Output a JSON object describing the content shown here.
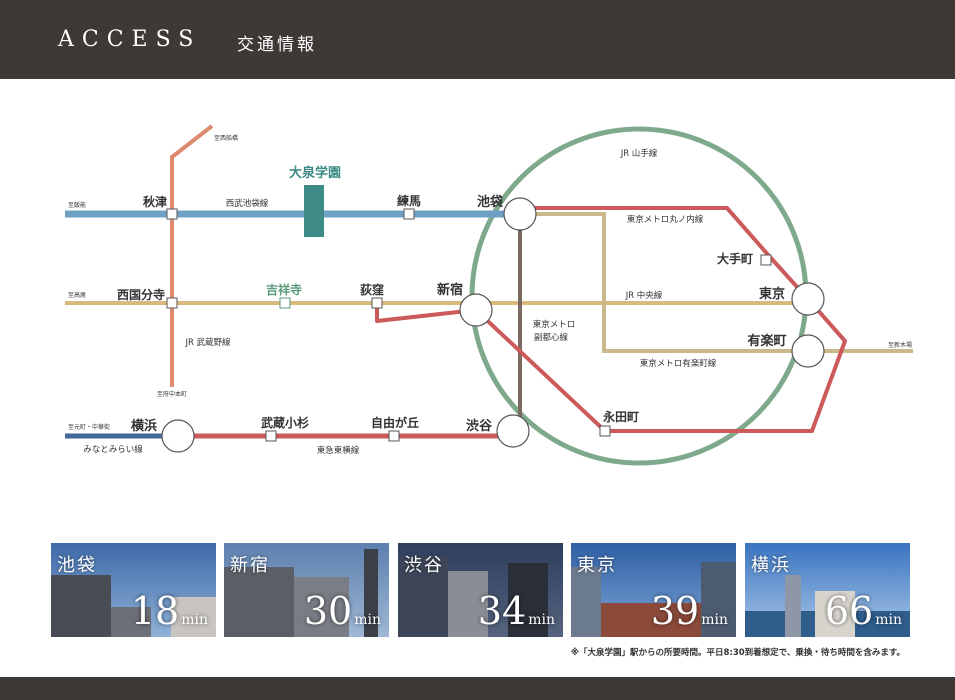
{
  "header": {
    "title_en": "ACCESS",
    "title_ja": "交通情報"
  },
  "colors": {
    "seibu": "#6ea0c6",
    "chuo": "#d9b97c",
    "musashino": "#dd8a6e",
    "marunouchi": "#cc5a5a",
    "yamanote": "#7ea98d",
    "fukutoshin": "#7c6a62",
    "yurakucho": "#c9b98a",
    "minatomirai": "#3f6a99",
    "tokyu": "#cc5a5a"
  },
  "map": {
    "stations": {
      "akitsu": "秋津",
      "nerima": "練馬",
      "ikebukuro": "池袋",
      "oizumi": "大泉学園",
      "nishikokubunji": "西国分寺",
      "kichijoji": "吉祥寺",
      "ogikubo": "荻窪",
      "shinjuku": "新宿",
      "otemachi": "大手町",
      "tokyo": "東京",
      "yurakucho": "有楽町",
      "nagatacho": "永田町",
      "yokohama": "横浜",
      "musashikosugi": "武蔵小杉",
      "jiyugaoka": "自由が丘",
      "shibuya": "渋谷"
    },
    "lines": {
      "yamanote": "JR 山手線",
      "seibu": "西武池袋線",
      "marunouchi": "東京メトロ丸ノ内線",
      "chuo": "JR 中央線",
      "musashino": "JR 武蔵野線",
      "fukutoshin_1": "東京メトロ",
      "fukutoshin_2": "副都心線",
      "yurakucho_line": "東京メトロ有楽町線",
      "tokyu": "東急東横線",
      "minatomirai": "みなとみらい線"
    },
    "directions": {
      "nishifunabashi": "至西船橋",
      "hanno": "至飯能",
      "takao": "至高尾",
      "fuchuhonmachi": "至府中本町",
      "shinkiba": "至新木場",
      "motomachi": "至元町・中華街"
    }
  },
  "times": [
    {
      "station": "池袋",
      "minutes": "18",
      "unit": "min"
    },
    {
      "station": "新宿",
      "minutes": "30",
      "unit": "min"
    },
    {
      "station": "渋谷",
      "minutes": "34",
      "unit": "min"
    },
    {
      "station": "東京",
      "minutes": "39",
      "unit": "min"
    },
    {
      "station": "横浜",
      "minutes": "66",
      "unit": "min"
    }
  ],
  "note": "※「大泉学園」駅からの所要時間。平日8:30到着想定で、乗換・待ち時間を含みます。"
}
